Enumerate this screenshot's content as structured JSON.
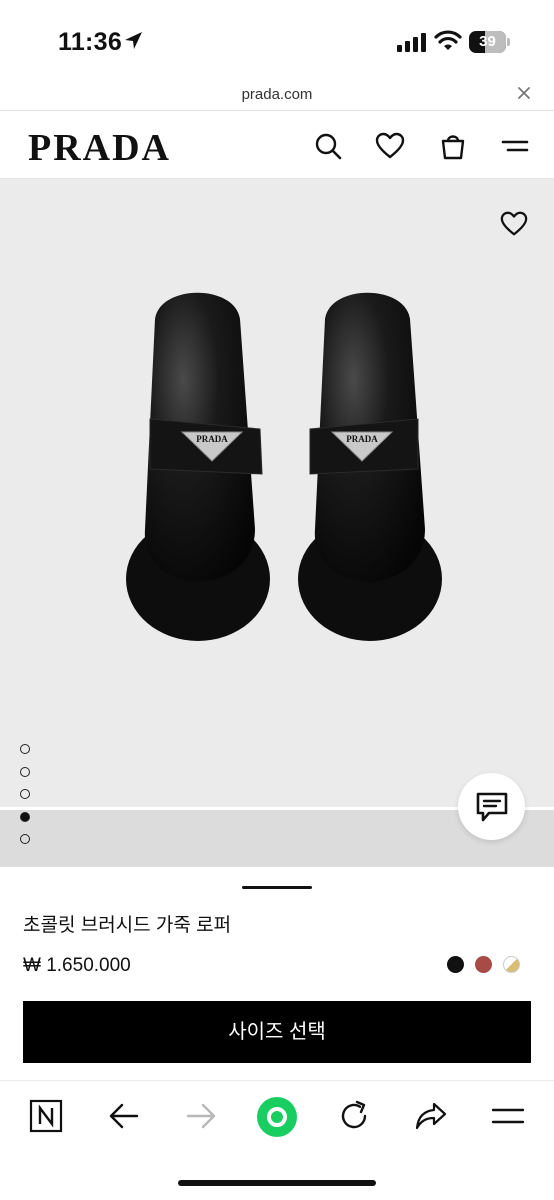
{
  "status_bar": {
    "time": "11:36",
    "battery": "39",
    "icons": [
      "location-arrow-icon",
      "signal-icon",
      "wifi-icon",
      "battery-icon"
    ]
  },
  "browser": {
    "url": "prada.com",
    "close_icon": "close-icon"
  },
  "site_header": {
    "logo": "PRADA",
    "icons": [
      "search-icon",
      "heart-icon",
      "bag-icon",
      "menu-icon"
    ]
  },
  "gallery": {
    "wishlist_icon": "heart-icon",
    "slide_count": 5,
    "active_slide_index": 3,
    "chat_icon": "chat-icon"
  },
  "product": {
    "name": "초콜릿 브러시드 가죽 로퍼",
    "price": "₩ 1.650.000",
    "swatches": [
      "#111111",
      "#a84a45",
      "#d9bf73"
    ],
    "size_button_label": "사이즈 선택"
  },
  "bottom_toolbar": {
    "icons": [
      "naver-n-icon",
      "back-arrow-icon",
      "forward-arrow-icon",
      "home-green-icon",
      "reload-icon",
      "share-icon",
      "menu-icon"
    ]
  }
}
